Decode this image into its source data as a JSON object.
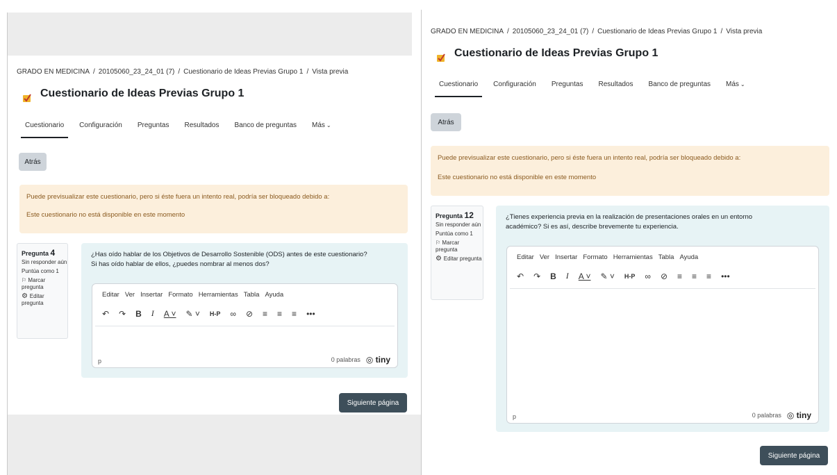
{
  "left": {
    "breadcrumb": [
      "GRADO EN MEDICINA",
      "20105060_23_24_01 (7)",
      "Cuestionario de Ideas Previas Grupo 1",
      "Vista previa"
    ],
    "title": "Cuestionario de Ideas Previas Grupo 1",
    "tabs": [
      "Cuestionario",
      "Configuración",
      "Preguntas",
      "Resultados",
      "Banco de preguntas",
      "Más"
    ],
    "back_label": "Atrás",
    "alert": {
      "line1": "Puede previsualizar este cuestionario, pero si éste fuera un intento real, podría ser bloqueado debido a:",
      "line2": "Este cuestionario no está disponible en este momento"
    },
    "question": {
      "label": "Pregunta",
      "number": "4",
      "status": "Sin responder aún",
      "score": "Puntúa como 1",
      "flag": "Marcar pregunta",
      "edit": "Editar pregunta",
      "text_line1": "¿Has oído hablar de los Objetivos de Desarrollo Sostenible (ODS) antes de este cuestionario?",
      "text_line2": "Si has oído hablar de ellos, ¿puedes nombrar al menos dos?"
    },
    "editor": {
      "menu": [
        "Editar",
        "Ver",
        "Insertar",
        "Formato",
        "Herramientas",
        "Tabla",
        "Ayuda"
      ],
      "path": "p",
      "word_count": "0 palabras",
      "brand": "tiny"
    },
    "next_label": "Siguiente página"
  },
  "right": {
    "breadcrumb": [
      "GRADO EN MEDICINA",
      "20105060_23_24_01 (7)",
      "Cuestionario de Ideas Previas Grupo 1",
      "Vista previa"
    ],
    "title": "Cuestionario de Ideas Previas Grupo 1",
    "tabs": [
      "Cuestionario",
      "Configuración",
      "Preguntas",
      "Resultados",
      "Banco de preguntas",
      "Más"
    ],
    "back_label": "Atrás",
    "alert": {
      "line1": "Puede previsualizar este cuestionario, pero si éste fuera un intento real, podría ser bloqueado debido a:",
      "line2": "Este cuestionario no está disponible en este momento"
    },
    "question": {
      "label": "Pregunta",
      "number": "12",
      "status": "Sin responder aún",
      "score": "Puntúa como 1",
      "flag": "Marcar pregunta",
      "edit": "Editar pregunta",
      "text_line1": "¿Tienes experiencia previa en la realización de presentaciones orales en un entorno",
      "text_line2": "académico? Si es así, describe brevemente tu experiencia."
    },
    "editor": {
      "menu": [
        "Editar",
        "Ver",
        "Insertar",
        "Formato",
        "Herramientas",
        "Tabla",
        "Ayuda"
      ],
      "path": "p",
      "word_count": "0 palabras",
      "brand": "tiny"
    },
    "next_label": "Siguiente página"
  },
  "toolbar_icons": [
    "undo-icon",
    "redo-icon",
    "bold-icon",
    "italic-icon",
    "text-color-icon",
    "highlight-icon",
    "hp-icon",
    "link-icon",
    "unlink-icon",
    "align-left-icon",
    "align-center-icon",
    "align-right-icon",
    "more-icon"
  ],
  "colors": {
    "alert_bg": "#fcefdc",
    "question_bg": "#e7f3f5",
    "next_button": "#3e4f5a",
    "back_button": "#ced4da"
  }
}
